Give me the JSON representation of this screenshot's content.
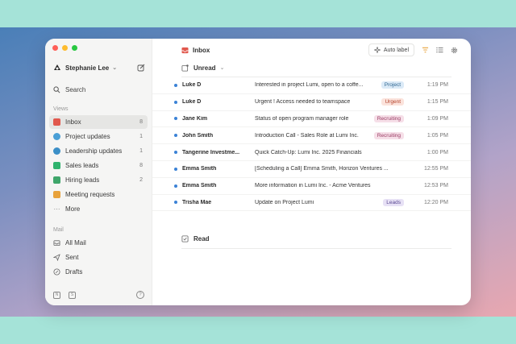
{
  "colors": {
    "unread_dot": "#3b82d6",
    "tag_project_bg": "#dbeaf7",
    "tag_project_fg": "#2f6690",
    "tag_urgent_bg": "#fbe3dc",
    "tag_urgent_fg": "#b4432c",
    "tag_recruiting_bg": "#f6dfe8",
    "tag_recruiting_fg": "#9a3b63",
    "tag_leads_bg": "#e7e1f5",
    "tag_leads_fg": "#5b4a93"
  },
  "sidebar": {
    "user_name": "Stephanie Lee",
    "search_label": "Search",
    "views_label": "Views",
    "views": [
      {
        "label": "Inbox",
        "count": "8",
        "icon": "inbox-icon",
        "color": "#e1584d"
      },
      {
        "label": "Project updates",
        "count": "1",
        "icon": "at-icon",
        "color": "#4a9fd6"
      },
      {
        "label": "Leadership updates",
        "count": "1",
        "icon": "info-icon",
        "color": "#3b8fc7"
      },
      {
        "label": "Sales leads",
        "count": "8",
        "icon": "mail-icon",
        "color": "#2fb36e"
      },
      {
        "label": "Hiring leads",
        "count": "2",
        "icon": "flag-icon",
        "color": "#3fa66b"
      },
      {
        "label": "Meeting requests",
        "count": "",
        "icon": "calendar-icon",
        "color": "#e8a23b"
      },
      {
        "label": "More",
        "count": "",
        "icon": "ellipsis-icon",
        "color": "#777777"
      }
    ],
    "mail_label": "Mail",
    "mail": [
      {
        "label": "All Mail",
        "icon": "tray-icon"
      },
      {
        "label": "Sent",
        "icon": "send-icon"
      },
      {
        "label": "Drafts",
        "icon": "draft-icon"
      }
    ],
    "footer": {
      "icon1": "N",
      "icon2": "S",
      "help": "?"
    }
  },
  "header": {
    "title": "Inbox",
    "auto_label": "Auto label"
  },
  "unread_group": {
    "label": "Unread",
    "emails": [
      {
        "sender": "Luke D",
        "subject": "Interested in project Lumi, open to a coffe...",
        "tag": "Project",
        "tag_type": "project",
        "time": "1:19 PM"
      },
      {
        "sender": "Luke D",
        "subject": "Urgent ! Access needed to teamspace",
        "tag": "Urgent",
        "tag_type": "urgent",
        "time": "1:15 PM"
      },
      {
        "sender": "Jane Kim",
        "subject": "Status of open program manager role",
        "tag": "Recruiting",
        "tag_type": "recruiting",
        "time": "1:09 PM"
      },
      {
        "sender": "John Smith",
        "subject": "Introduction Call - Sales Role at Lumi Inc.",
        "tag": "Recruiting",
        "tag_type": "recruiting",
        "time": "1:05 PM"
      },
      {
        "sender": "Tangerine Investme...",
        "subject": "Quick Catch-Up: Lumi Inc. 2025 Financials",
        "tag": "",
        "tag_type": "",
        "time": "1:00 PM"
      },
      {
        "sender": "Emma Smith",
        "subject": "[Scheduling a Call] Emma Smith, Horizon Ventures ...",
        "tag": "",
        "tag_type": "",
        "time": "12:55 PM"
      },
      {
        "sender": "Emma Smith",
        "subject": "More information in Lumi Inc. - Acme Ventures",
        "tag": "",
        "tag_type": "",
        "time": "12:53 PM"
      },
      {
        "sender": "Trisha Mae",
        "subject": "Update on Project Lumi",
        "tag": "Leads",
        "tag_type": "leads",
        "time": "12:20 PM"
      }
    ]
  },
  "read_group": {
    "label": "Read"
  }
}
